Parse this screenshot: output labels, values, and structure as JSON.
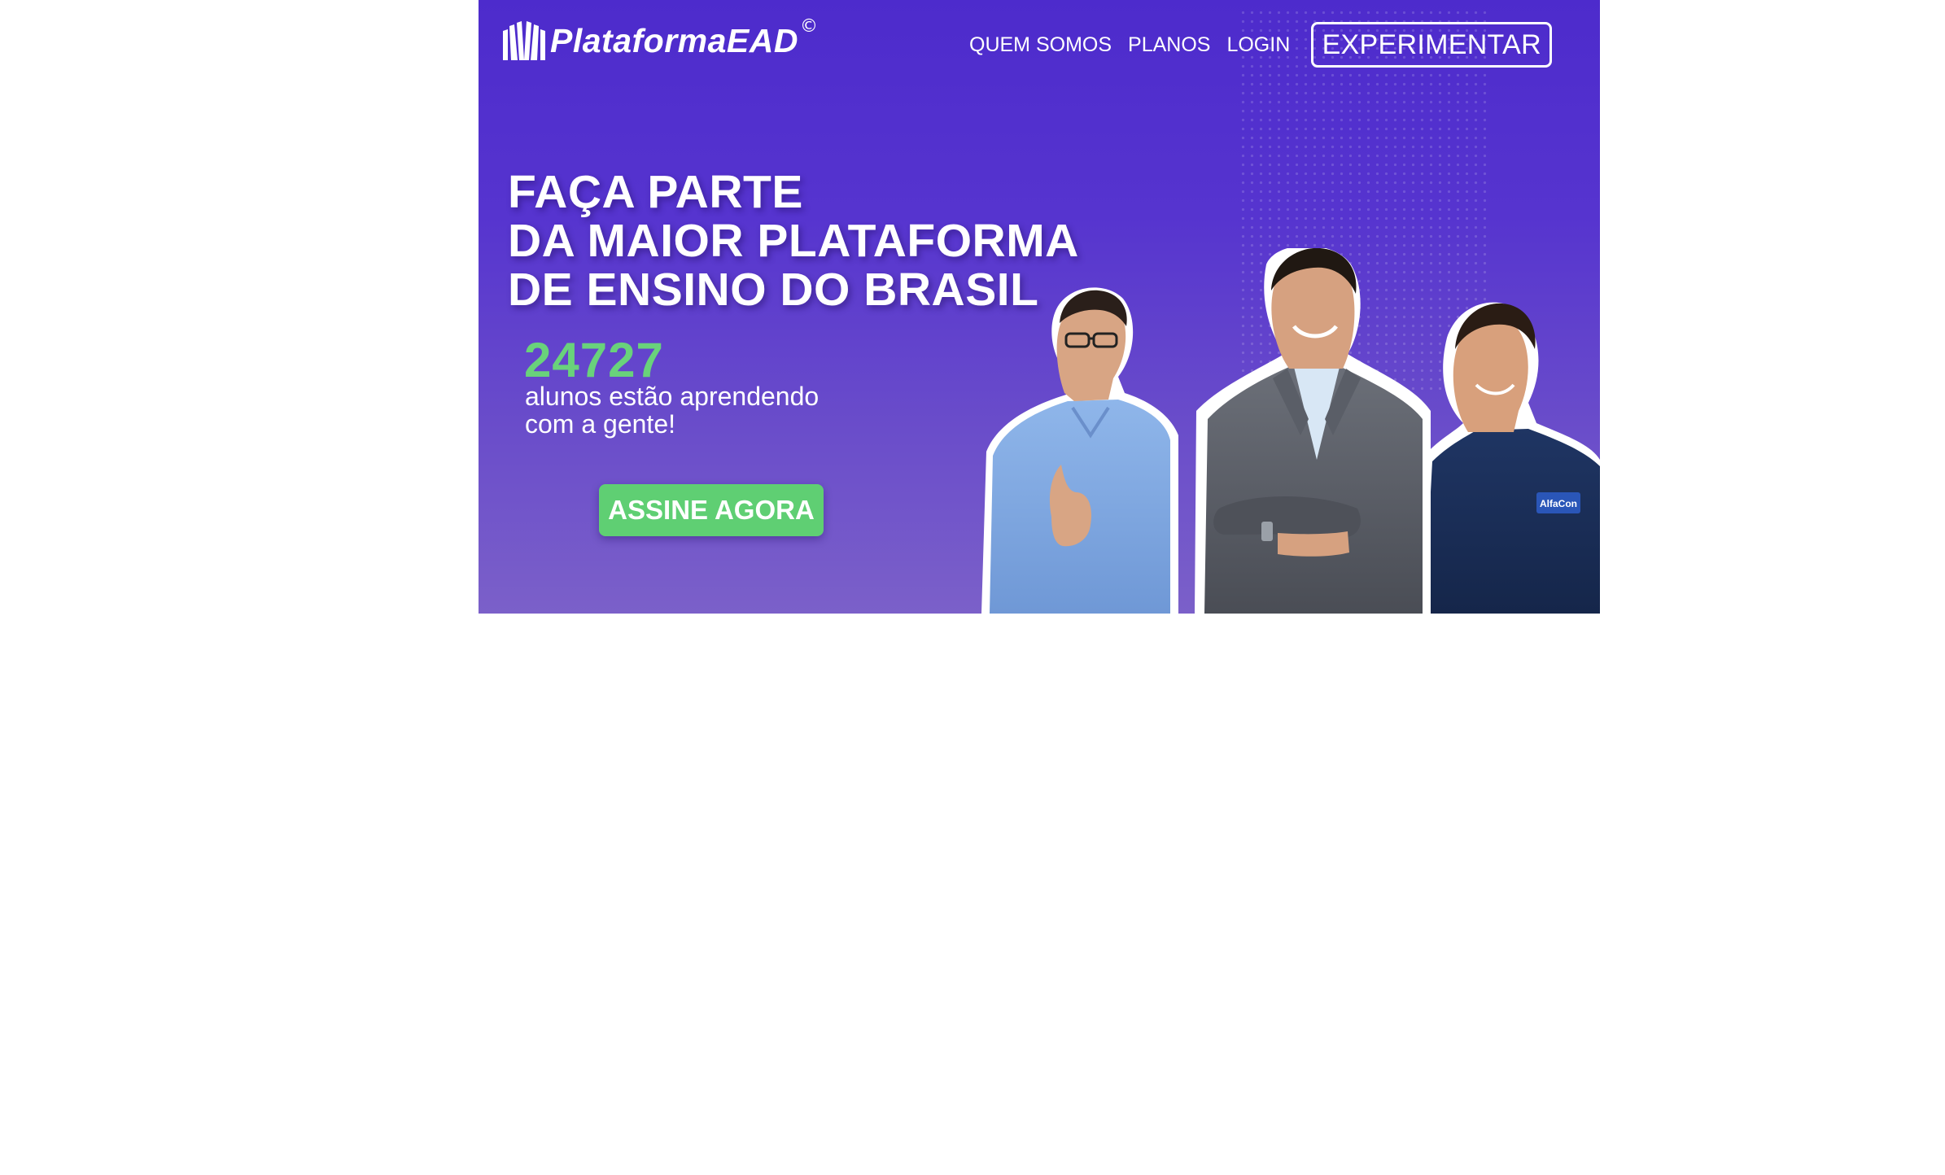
{
  "header": {
    "logo_text": "PlataformaEAD",
    "logo_mark": "©",
    "nav": [
      {
        "label": "QUEM SOMOS"
      },
      {
        "label": "PLANOS"
      },
      {
        "label": "LOGIN"
      }
    ],
    "cta_label": "EXPERIMENTAR"
  },
  "hero": {
    "headline": [
      "FAÇA PARTE",
      "DA MAIOR PLATAFORMA",
      "DE ENSINO DO BRASIL"
    ],
    "counter": "24727",
    "subtext": [
      "alunos estão aprendendo",
      "com a gente!"
    ],
    "cta_label": "ASSINE AGORA",
    "badge_text": "AlfaCon"
  },
  "colors": {
    "banner_top": "#4d2bcc",
    "banner_bottom": "#7b60c9",
    "counter": "#69d27b",
    "cta": "#5fcf73"
  }
}
